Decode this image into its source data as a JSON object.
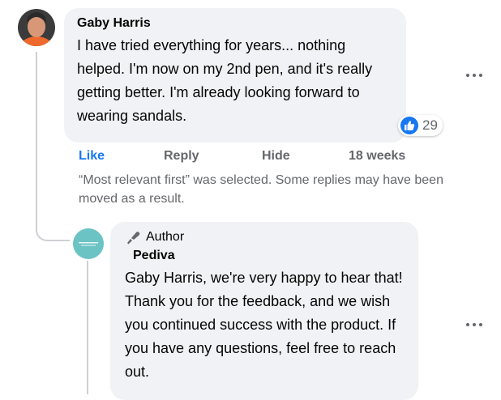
{
  "comment": {
    "author": "Gaby Harris",
    "text": "I have tried everything for years... nothing helped. I'm now on my 2nd pen, and it's really getting better. I'm already looking forward to wearing sandals.",
    "reaction_count": "29",
    "actions": {
      "like": "Like",
      "reply": "Reply",
      "hide": "Hide",
      "time": "18 weeks"
    }
  },
  "notice": "“Most relevant first” was selected. Some replies may have been moved as a result.",
  "reply": {
    "badge": "Author",
    "author": "Pediva",
    "text": "Gaby Harris, we're very happy to hear that! Thank you for the feedback, and we wish you continued success with the product. If you have any questions, feel free to reach out."
  },
  "colors": {
    "like_blue": "#1877f2",
    "bubble_bg": "#f0f2f5",
    "muted_text": "#65676b",
    "avatar_teal": "#6cc3c4"
  },
  "icons": [
    "like-icon",
    "more-options-icon",
    "author-badge-icon"
  ]
}
